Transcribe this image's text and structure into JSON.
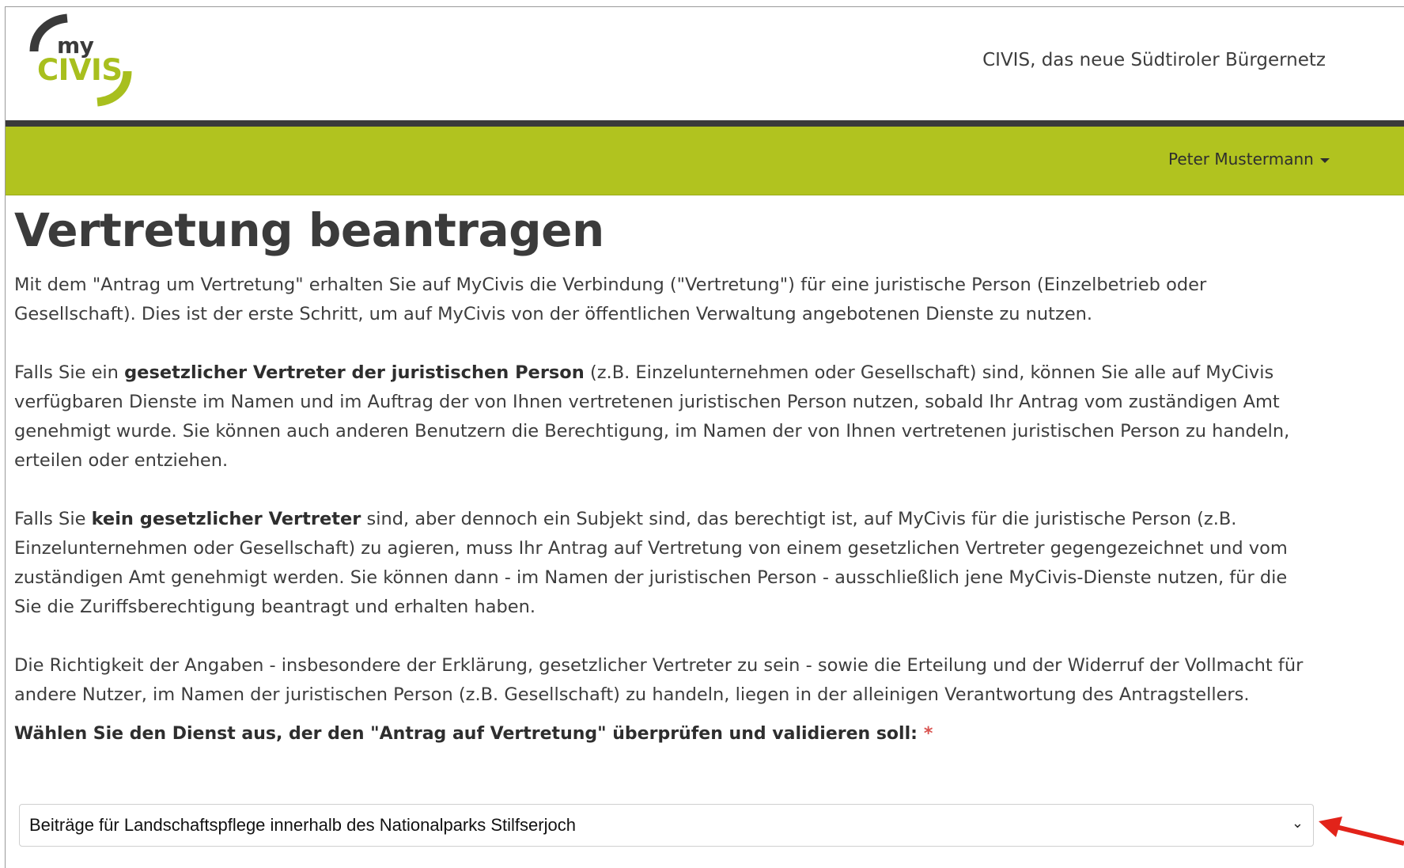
{
  "header": {
    "logo_my": "my",
    "logo_civis": "CIVIS",
    "tagline": "CIVIS, das neue Südtiroler Bürgernetz"
  },
  "nav": {
    "user_name": "Peter Mustermann"
  },
  "colors": {
    "brand_green": "#b1c31f",
    "dark_bar": "#3a3a3a",
    "required_star": "#d9534f",
    "arrow_red": "#e2231a"
  },
  "main": {
    "title": "Vertretung beantragen",
    "p1": "Mit dem \"Antrag um Vertretung\" erhalten Sie auf MyCivis die Verbindung (\"Vertretung\") für eine juristische Person (Einzelbetrieb oder Gesellschaft). Dies ist der erste Schritt, um auf MyCivis von der öffentlichen Verwaltung angebotenen Dienste zu nutzen.",
    "p2_a": "Falls Sie ein ",
    "p2_b": "gesetzlicher Vertreter der juristischen Person",
    "p2_c": " (z.B. Einzelunternehmen oder Gesellschaft) sind, können Sie alle auf MyCivis verfügbaren Dienste im Namen und im Auftrag der von Ihnen vertretenen juristischen Person nutzen, sobald Ihr Antrag vom zuständigen Amt genehmigt wurde. Sie können auch anderen Benutzern die Berechtigung, im Namen der von Ihnen vertretenen juristischen Person zu handeln, erteilen oder entziehen.",
    "p3_a": "Falls Sie ",
    "p3_b": "kein gesetzlicher Vertreter",
    "p3_c": " sind, aber dennoch ein Subjekt sind, das berechtigt ist, auf MyCivis für die juristische Person (z.B. Einzelunternehmen oder Gesellschaft) zu agieren, muss Ihr Antrag auf Vertretung von einem gesetzlichen Vertreter gegengezeichnet und vom zuständigen Amt genehmigt werden. Sie können dann - im Namen der juristischen Person - ausschließlich jene MyCivis-Dienste nutzen, für die Sie die Zuriffsberechtigung beantragt und erhalten haben.",
    "p4": "Die Richtigkeit der Angaben - insbesondere der Erklärung, gesetzlicher Vertreter zu sein - sowie die Erteilung und der Widerruf der Vollmacht für andere Nutzer, im Namen der juristischen Person (z.B. Gesellschaft) zu handeln, liegen in der alleinigen Verantwortung des Antragstellers.",
    "field_label": "Wählen Sie den Dienst aus, der den \"Antrag auf Vertretung\" überprüfen und validieren soll:",
    "required_mark": "*",
    "select_value": "Beiträge für Landschaftspflege innerhalb des Nationalparks Stilfserjoch",
    "select_chevron": "⌄"
  }
}
